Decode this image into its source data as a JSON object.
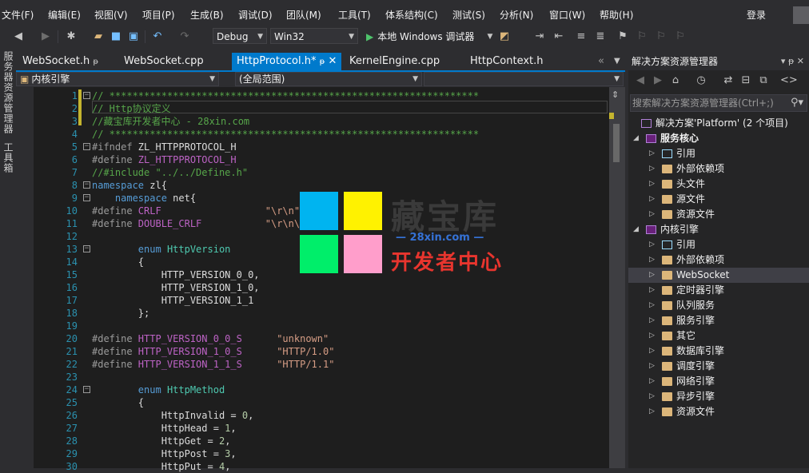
{
  "menu": [
    "文件(F)",
    "编辑(E)",
    "视图(V)",
    "项目(P)",
    "生成(B)",
    "调试(D)",
    "团队(M)",
    "工具(T)",
    "体系结构(C)",
    "测试(S)",
    "分析(N)",
    "窗口(W)",
    "帮助(H)"
  ],
  "login": "登录",
  "toolbar": {
    "config": "Debug",
    "platform": "Win32",
    "run": "本地 Windows 调试器"
  },
  "left_strip": [
    "服务器资源管理器",
    "工具箱"
  ],
  "doc_tabs": [
    {
      "label": "WebSocket.h",
      "pin": "ᵽ"
    },
    {
      "label": "WebSocket.cpp"
    },
    {
      "label": "HttpProtocol.h*",
      "pin": "ᵽ",
      "close": "✕",
      "active": true
    },
    {
      "label": "KernelEngine.cpp"
    },
    {
      "label": "HttpContext.h"
    }
  ],
  "navbar": {
    "scope": "内核引擎",
    "member": "(全局范围)"
  },
  "code_lines": [
    {
      "n": "1",
      "t": [
        [
          "c-com",
          "// ****************************************************************"
        ]
      ]
    },
    {
      "n": "2",
      "t": [
        [
          "c-com",
          "// Http协议定义"
        ]
      ]
    },
    {
      "n": "3",
      "t": [
        [
          "c-com",
          "//藏宝库开发者中心 - 28xin.com"
        ]
      ]
    },
    {
      "n": "4",
      "t": [
        [
          "c-com",
          "// ****************************************************************"
        ]
      ]
    },
    {
      "n": "5",
      "t": [
        [
          "c-pp",
          "#ifndef "
        ],
        [
          "",
          "ZL_HTTPPROTOCOL_H"
        ]
      ]
    },
    {
      "n": "6",
      "t": [
        [
          "c-pp",
          "#define "
        ],
        [
          "c-mac",
          "ZL_HTTPPROTOCOL_H"
        ]
      ]
    },
    {
      "n": "7",
      "t": [
        [
          "c-com",
          "//#include \"../../Define.h\""
        ]
      ]
    },
    {
      "n": "8",
      "t": [
        [
          "c-kw",
          "namespace"
        ],
        [
          "",
          " zl{"
        ]
      ]
    },
    {
      "n": "9",
      "t": [
        [
          "",
          "    "
        ],
        [
          "c-kw",
          "namespace"
        ],
        [
          "",
          " net{"
        ]
      ]
    },
    {
      "n": "10",
      "t": [
        [
          "c-pp",
          "#define "
        ],
        [
          "c-mac",
          "CRLF"
        ],
        [
          "",
          "                  "
        ],
        [
          "c-str",
          "\"\\r\\n\""
        ]
      ]
    },
    {
      "n": "11",
      "t": [
        [
          "c-pp",
          "#define "
        ],
        [
          "c-mac",
          "DOUBLE_CRLF"
        ],
        [
          "",
          "           "
        ],
        [
          "c-str",
          "\"\\r\\n\\r\\n\""
        ]
      ]
    },
    {
      "n": "12",
      "t": [
        [
          "",
          ""
        ]
      ]
    },
    {
      "n": "13",
      "t": [
        [
          "",
          "        "
        ],
        [
          "c-kw",
          "enum"
        ],
        [
          "",
          " "
        ],
        [
          "c-enum",
          "HttpVersion"
        ]
      ]
    },
    {
      "n": "14",
      "t": [
        [
          "",
          "        {"
        ]
      ]
    },
    {
      "n": "15",
      "t": [
        [
          "",
          "            HTTP_VERSION_0_0,"
        ]
      ]
    },
    {
      "n": "16",
      "t": [
        [
          "",
          "            HTTP_VERSION_1_0,"
        ]
      ]
    },
    {
      "n": "17",
      "t": [
        [
          "",
          "            HTTP_VERSION_1_1"
        ]
      ]
    },
    {
      "n": "18",
      "t": [
        [
          "",
          "        };"
        ]
      ]
    },
    {
      "n": "19",
      "t": [
        [
          "",
          ""
        ]
      ]
    },
    {
      "n": "20",
      "t": [
        [
          "c-pp",
          "#define "
        ],
        [
          "c-mac",
          "HTTP_VERSION_0_0_S"
        ],
        [
          "",
          "      "
        ],
        [
          "c-str",
          "\"unknown\""
        ]
      ]
    },
    {
      "n": "21",
      "t": [
        [
          "c-pp",
          "#define "
        ],
        [
          "c-mac",
          "HTTP_VERSION_1_0_S"
        ],
        [
          "",
          "      "
        ],
        [
          "c-str",
          "\"HTTP/1.0\""
        ]
      ]
    },
    {
      "n": "22",
      "t": [
        [
          "c-pp",
          "#define "
        ],
        [
          "c-mac",
          "HTTP_VERSION_1_1_S"
        ],
        [
          "",
          "      "
        ],
        [
          "c-str",
          "\"HTTP/1.1\""
        ]
      ]
    },
    {
      "n": "23",
      "t": [
        [
          "",
          ""
        ]
      ]
    },
    {
      "n": "24",
      "t": [
        [
          "",
          "        "
        ],
        [
          "c-kw",
          "enum"
        ],
        [
          "",
          " "
        ],
        [
          "c-enum",
          "HttpMethod"
        ]
      ]
    },
    {
      "n": "25",
      "t": [
        [
          "",
          "        {"
        ]
      ]
    },
    {
      "n": "26",
      "t": [
        [
          "",
          "            HttpInvalid = "
        ],
        [
          "c-num",
          "0"
        ],
        [
          "",
          ","
        ]
      ]
    },
    {
      "n": "27",
      "t": [
        [
          "",
          "            HttpHead = "
        ],
        [
          "c-num",
          "1"
        ],
        [
          "",
          ","
        ]
      ]
    },
    {
      "n": "28",
      "t": [
        [
          "",
          "            HttpGet = "
        ],
        [
          "c-num",
          "2"
        ],
        [
          "",
          ","
        ]
      ]
    },
    {
      "n": "29",
      "t": [
        [
          "",
          "            HttpPost = "
        ],
        [
          "c-num",
          "3"
        ],
        [
          "",
          ","
        ]
      ]
    },
    {
      "n": "30",
      "t": [
        [
          "",
          "            HttpPut = "
        ],
        [
          "c-num",
          "4"
        ],
        [
          "",
          ","
        ]
      ]
    }
  ],
  "fold_lines": [
    "1",
    "5",
    "8",
    "9",
    "13",
    "24"
  ],
  "watermark": {
    "title": "藏宝库",
    "url": "— 28xin.com —",
    "sub": "开发者中心",
    "colors": [
      "#00b4f0",
      "#fff200",
      "#00ee6a",
      "#ff9ecb"
    ]
  },
  "solution_explorer": {
    "title": "解决方案资源管理器",
    "search_placeholder": "搜索解决方案资源管理器(Ctrl+;)",
    "items": [
      {
        "label": "解决方案'Platform' (2 个项目)",
        "level": 0,
        "kind": "sol",
        "exp": ""
      },
      {
        "label": "服务核心",
        "level": 1,
        "kind": "proj",
        "exp": "◢",
        "bold": true
      },
      {
        "label": "引用",
        "level": 2,
        "kind": "refs",
        "exp": "▷"
      },
      {
        "label": "外部依赖项",
        "level": 2,
        "kind": "folder",
        "exp": "▷"
      },
      {
        "label": "头文件",
        "level": 2,
        "kind": "folder",
        "exp": "▷"
      },
      {
        "label": "源文件",
        "level": 2,
        "kind": "folder",
        "exp": "▷"
      },
      {
        "label": "资源文件",
        "level": 2,
        "kind": "folder",
        "exp": "▷"
      },
      {
        "label": "内核引擎",
        "level": 1,
        "kind": "proj",
        "exp": "◢"
      },
      {
        "label": "引用",
        "level": 2,
        "kind": "refs",
        "exp": "▷"
      },
      {
        "label": "外部依赖项",
        "level": 2,
        "kind": "folder",
        "exp": "▷"
      },
      {
        "label": "WebSocket",
        "level": 2,
        "kind": "folder",
        "exp": "▷",
        "selected": true
      },
      {
        "label": "定时器引擎",
        "level": 2,
        "kind": "folder",
        "exp": "▷"
      },
      {
        "label": "队列服务",
        "level": 2,
        "kind": "folder",
        "exp": "▷"
      },
      {
        "label": "服务引擎",
        "level": 2,
        "kind": "folder",
        "exp": "▷"
      },
      {
        "label": "其它",
        "level": 2,
        "kind": "folder",
        "exp": "▷"
      },
      {
        "label": "数据库引擎",
        "level": 2,
        "kind": "folder",
        "exp": "▷"
      },
      {
        "label": "调度引擎",
        "level": 2,
        "kind": "folder",
        "exp": "▷"
      },
      {
        "label": "网络引擎",
        "level": 2,
        "kind": "folder",
        "exp": "▷"
      },
      {
        "label": "异步引擎",
        "level": 2,
        "kind": "folder",
        "exp": "▷"
      },
      {
        "label": "资源文件",
        "level": 2,
        "kind": "folder",
        "exp": "▷"
      }
    ]
  }
}
